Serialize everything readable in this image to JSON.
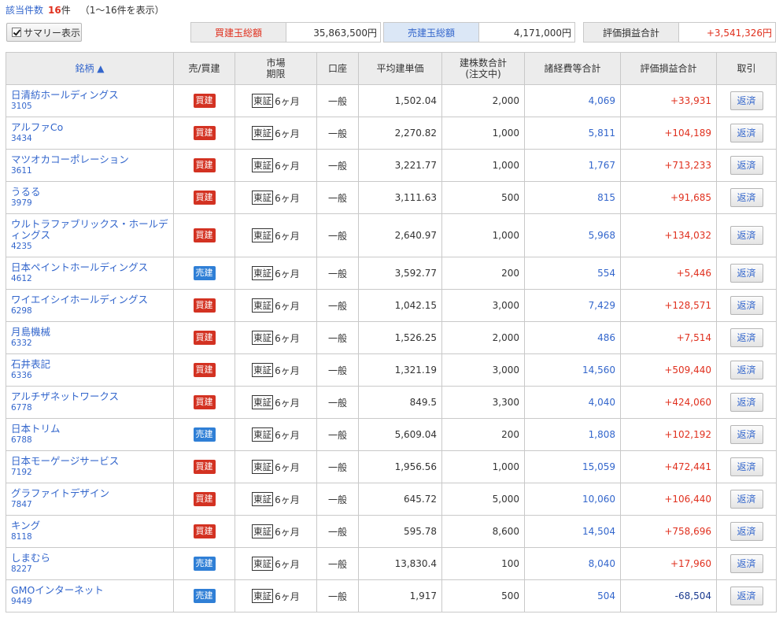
{
  "header": {
    "count_label": "該当件数",
    "count_value": "16",
    "count_unit": "件",
    "range_text": "（1〜16件を表示）",
    "summary_button": "サマリー表示"
  },
  "summary": {
    "buy_label": "買建玉総額",
    "buy_value": "35,863,500円",
    "sell_label": "売建玉総額",
    "sell_value": "4,171,000円",
    "pl_label": "評価損益合計",
    "pl_value": "+3,541,326円"
  },
  "columns": {
    "name": "銘柄",
    "sort_icon": "▲",
    "side": "売/買建",
    "market_line1": "市場",
    "market_line2": "期限",
    "account": "口座",
    "avg_price": "平均建単価",
    "qty_line1": "建株数合計",
    "qty_line2": "(注文中)",
    "fees": "諸経費等合計",
    "pl": "評価損益合計",
    "trade": "取引"
  },
  "rows": [
    {
      "name": "日清紡ホールディングス",
      "code": "3105",
      "side": "買建",
      "side_type": "buy",
      "market": "東証",
      "term": "6ヶ月",
      "account": "一般",
      "avg": "1,502.04",
      "qty": "2,000",
      "fees": "4,069",
      "pl": "+33,931",
      "pl_sign": "plus",
      "action": "返済"
    },
    {
      "name": "アルファCo",
      "code": "3434",
      "side": "買建",
      "side_type": "buy",
      "market": "東証",
      "term": "6ヶ月",
      "account": "一般",
      "avg": "2,270.82",
      "qty": "1,000",
      "fees": "5,811",
      "pl": "+104,189",
      "pl_sign": "plus",
      "action": "返済"
    },
    {
      "name": "マツオカコーポレーション",
      "code": "3611",
      "side": "買建",
      "side_type": "buy",
      "market": "東証",
      "term": "6ヶ月",
      "account": "一般",
      "avg": "3,221.77",
      "qty": "1,000",
      "fees": "1,767",
      "pl": "+713,233",
      "pl_sign": "plus",
      "action": "返済"
    },
    {
      "name": "うるる",
      "code": "3979",
      "side": "買建",
      "side_type": "buy",
      "market": "東証",
      "term": "6ヶ月",
      "account": "一般",
      "avg": "3,111.63",
      "qty": "500",
      "fees": "815",
      "pl": "+91,685",
      "pl_sign": "plus",
      "action": "返済"
    },
    {
      "name": "ウルトラファブリックス・ホールディングス",
      "code": "4235",
      "side": "買建",
      "side_type": "buy",
      "market": "東証",
      "term": "6ヶ月",
      "account": "一般",
      "avg": "2,640.97",
      "qty": "1,000",
      "fees": "5,968",
      "pl": "+134,032",
      "pl_sign": "plus",
      "action": "返済",
      "tall": true
    },
    {
      "name": "日本ペイントホールディングス",
      "code": "4612",
      "side": "売建",
      "side_type": "sell",
      "market": "東証",
      "term": "6ヶ月",
      "account": "一般",
      "avg": "3,592.77",
      "qty": "200",
      "fees": "554",
      "pl": "+5,446",
      "pl_sign": "plus",
      "action": "返済"
    },
    {
      "name": "ワイエイシイホールディングス",
      "code": "6298",
      "side": "買建",
      "side_type": "buy",
      "market": "東証",
      "term": "6ヶ月",
      "account": "一般",
      "avg": "1,042.15",
      "qty": "3,000",
      "fees": "7,429",
      "pl": "+128,571",
      "pl_sign": "plus",
      "action": "返済"
    },
    {
      "name": "月島機械",
      "code": "6332",
      "side": "買建",
      "side_type": "buy",
      "market": "東証",
      "term": "6ヶ月",
      "account": "一般",
      "avg": "1,526.25",
      "qty": "2,000",
      "fees": "486",
      "pl": "+7,514",
      "pl_sign": "plus",
      "action": "返済"
    },
    {
      "name": "石井表記",
      "code": "6336",
      "side": "買建",
      "side_type": "buy",
      "market": "東証",
      "term": "6ヶ月",
      "account": "一般",
      "avg": "1,321.19",
      "qty": "3,000",
      "fees": "14,560",
      "pl": "+509,440",
      "pl_sign": "plus",
      "action": "返済"
    },
    {
      "name": "アルチザネットワークス",
      "code": "6778",
      "side": "買建",
      "side_type": "buy",
      "market": "東証",
      "term": "6ヶ月",
      "account": "一般",
      "avg": "849.5",
      "qty": "3,300",
      "fees": "4,040",
      "pl": "+424,060",
      "pl_sign": "plus",
      "action": "返済"
    },
    {
      "name": "日本トリム",
      "code": "6788",
      "side": "売建",
      "side_type": "sell",
      "market": "東証",
      "term": "6ヶ月",
      "account": "一般",
      "avg": "5,609.04",
      "qty": "200",
      "fees": "1,808",
      "pl": "+102,192",
      "pl_sign": "plus",
      "action": "返済"
    },
    {
      "name": "日本モーゲージサービス",
      "code": "7192",
      "side": "買建",
      "side_type": "buy",
      "market": "東証",
      "term": "6ヶ月",
      "account": "一般",
      "avg": "1,956.56",
      "qty": "1,000",
      "fees": "15,059",
      "pl": "+472,441",
      "pl_sign": "plus",
      "action": "返済"
    },
    {
      "name": "グラファイトデザイン",
      "code": "7847",
      "side": "買建",
      "side_type": "buy",
      "market": "東証",
      "term": "6ヶ月",
      "account": "一般",
      "avg": "645.72",
      "qty": "5,000",
      "fees": "10,060",
      "pl": "+106,440",
      "pl_sign": "plus",
      "action": "返済"
    },
    {
      "name": "キング",
      "code": "8118",
      "side": "買建",
      "side_type": "buy",
      "market": "東証",
      "term": "6ヶ月",
      "account": "一般",
      "avg": "595.78",
      "qty": "8,600",
      "fees": "14,504",
      "pl": "+758,696",
      "pl_sign": "plus",
      "action": "返済"
    },
    {
      "name": "しまむら",
      "code": "8227",
      "side": "売建",
      "side_type": "sell",
      "market": "東証",
      "term": "6ヶ月",
      "account": "一般",
      "avg": "13,830.4",
      "qty": "100",
      "fees": "8,040",
      "pl": "+17,960",
      "pl_sign": "plus",
      "action": "返済"
    },
    {
      "name": "GMOインターネット",
      "code": "9449",
      "side": "売建",
      "side_type": "sell",
      "market": "東証",
      "term": "6ヶ月",
      "account": "一般",
      "avg": "1,917",
      "qty": "500",
      "fees": "504",
      "pl": "-68,504",
      "pl_sign": "minus",
      "action": "返済"
    }
  ],
  "colors": {
    "buy_tag": "#d33222",
    "sell_tag": "#2f7fd6",
    "link": "#3366cc",
    "positive": "#e0301e",
    "negative": "#1a3a8f"
  }
}
